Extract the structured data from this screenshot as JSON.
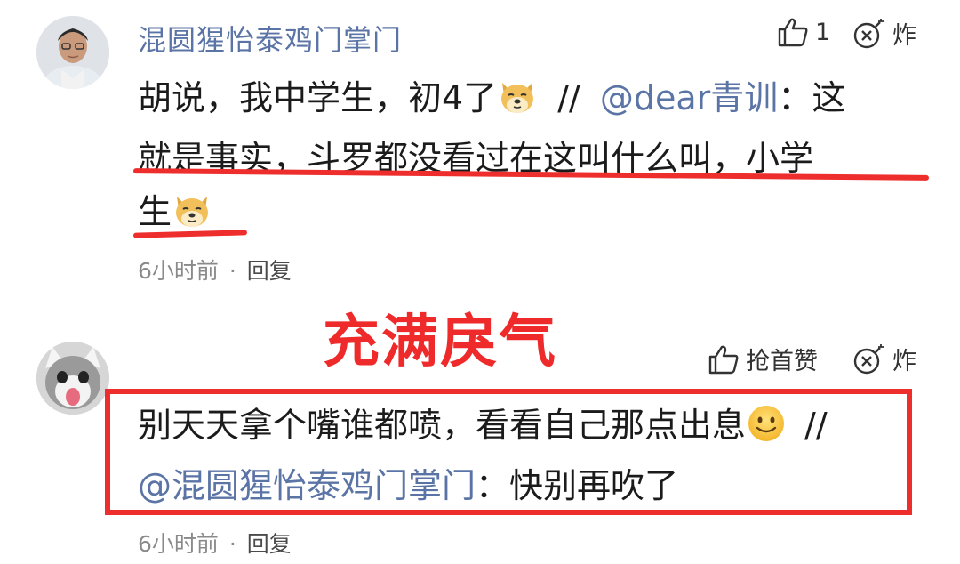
{
  "comments": [
    {
      "username": "混圆猩怡泰鸡门掌门",
      "like_count": "1",
      "bomb_label": "炸",
      "line1_text": "胡说，我中学生，初4了",
      "separator": "//",
      "mention": "@dear青训",
      "line1_after": "：这",
      "line2_text": "就是事实，斗罗都没看过在这叫什么叫，小学",
      "line3_text": "生",
      "time": "6小时前",
      "dot": "·",
      "reply_label": "回复",
      "colors": {
        "username": "#5b74a6",
        "mention": "#5b74a6"
      }
    },
    {
      "username": "",
      "like_label": "抢首赞",
      "bomb_label": "炸",
      "line1_text": "别天天拿个嘴谁都喷，看看自己那点出息",
      "separator": "//",
      "mention": "@混圆猩怡泰鸡门掌门",
      "line2_after": "：快别再吹了",
      "time": "6小时前",
      "dot": "·",
      "reply_label": "回复"
    }
  ],
  "overlay": {
    "title": "充满戾气",
    "color": "#ee2a2a"
  },
  "icons": {
    "like": "thumb-up-icon",
    "bomb": "bomb-icon",
    "doge": "doge-emoji-icon",
    "smile": "smile-emoji-icon"
  }
}
